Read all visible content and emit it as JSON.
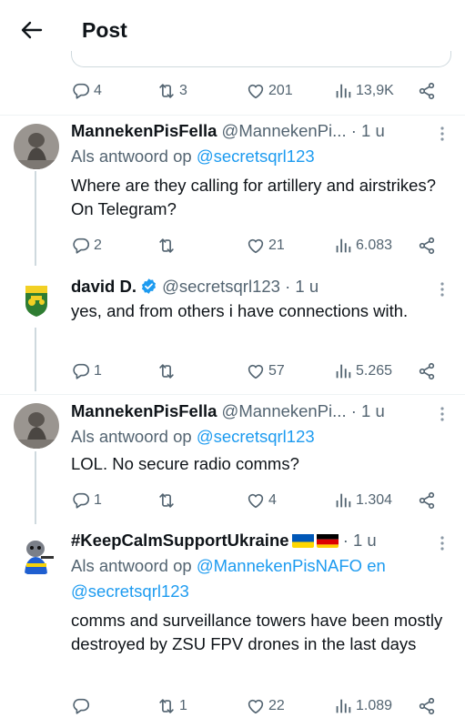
{
  "header": {
    "title": "Post"
  },
  "top_post": {
    "stats": {
      "replies": "4",
      "reposts": "3",
      "likes": "201",
      "views": "13,9K"
    }
  },
  "replies": [
    {
      "display_name": "MannekenPisFella",
      "handle": "@MannekenPi...",
      "time": "· 1 u",
      "replying_prefix": "Als antwoord op",
      "replying_to": "@secretsqrl123",
      "text": "Where are they calling for artillery and airstrikes? On Telegram?",
      "stats": {
        "replies": "2",
        "reposts": "",
        "likes": "21",
        "views": "6.083"
      }
    },
    {
      "display_name": "david D.",
      "handle": "@secretsqrl123",
      "time": "· 1 u",
      "text": "yes, and from others i have connections with.",
      "stats": {
        "replies": "1",
        "reposts": "",
        "likes": "57",
        "views": "5.265"
      }
    },
    {
      "display_name": "MannekenPisFella",
      "handle": "@MannekenPi...",
      "time": "· 1 u",
      "replying_prefix": "Als antwoord op",
      "replying_to": "@secretsqrl123",
      "text": "LOL. No secure radio comms?",
      "stats": {
        "replies": "1",
        "reposts": "",
        "likes": "4",
        "views": "1.304"
      }
    },
    {
      "display_name": "#KeepCalmSupportUkraine",
      "time": "· 1 u",
      "replying_prefix": "Als antwoord op",
      "replying_to_1": "@MannekenPisNAFO",
      "replying_join": "en",
      "replying_to_2": "@secretsqrl123",
      "text": "comms and surveillance towers have been mostly destroyed by ZSU FPV drones in the last days",
      "stats": {
        "replies": "",
        "reposts": "1",
        "likes": "22",
        "views": "1.089"
      }
    }
  ],
  "colors": {
    "accent": "#1d9bf0",
    "muted": "#536471",
    "text": "#0f1419",
    "divider": "#eff3f4"
  },
  "icons": [
    "back-arrow-icon",
    "reply-icon",
    "repost-icon",
    "like-icon",
    "views-icon",
    "share-icon",
    "more-icon",
    "verified-icon"
  ]
}
